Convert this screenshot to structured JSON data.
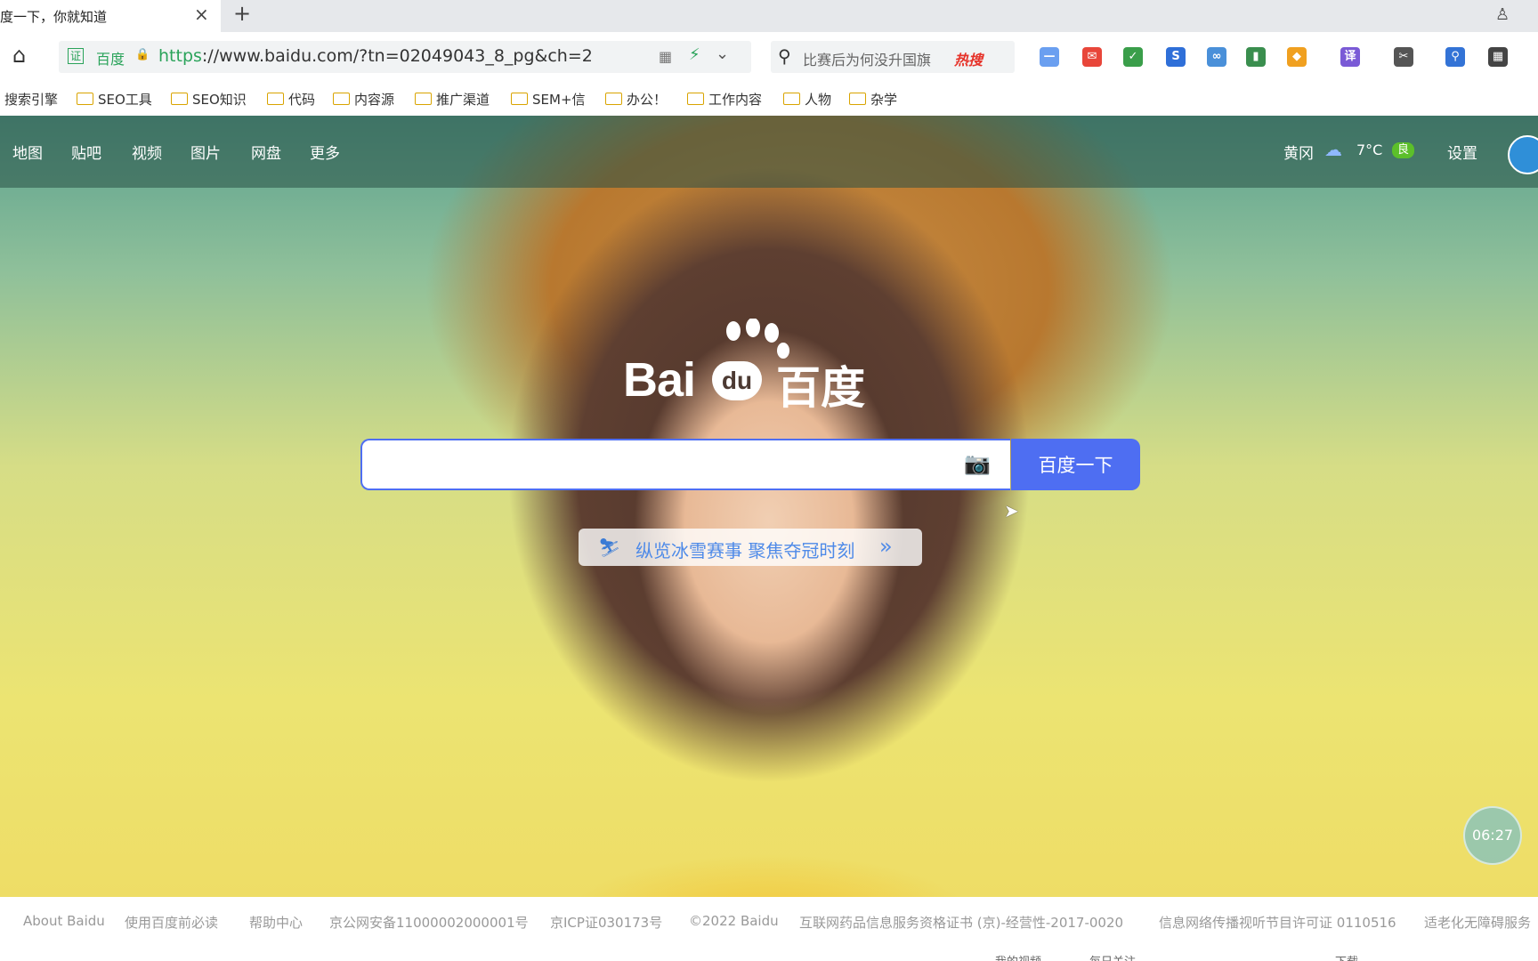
{
  "browser": {
    "tab_title": "度一下，你就知道",
    "tab_close": "×",
    "new_tab": "+",
    "address": {
      "cert_badge": "证",
      "cert_name": "百度",
      "url_scheme": "https",
      "url_rest": "://www.baidu.com/?tn=02049043_8_pg&ch=2"
    },
    "side_search": {
      "text": "比赛后为何没升国旗",
      "hot": "热搜"
    },
    "extensions": [
      "minus-icon",
      "message-icon",
      "check-icon",
      "sogou-icon",
      "link-icon",
      "chart-icon",
      "shield-icon",
      "translate-icon",
      "scissors-icon",
      "magnifier-icon",
      "grid-icon"
    ],
    "extension_labels": [
      "—",
      "✉",
      "✓",
      "S",
      "∞",
      "▮",
      "◆",
      "译",
      "✂",
      "⚲",
      "▦"
    ],
    "extension_colors": [
      "#6a9ff0",
      "#e8463a",
      "#3a9e4a",
      "#2f6fd8",
      "#4a90d9",
      "#3a8e4e",
      "#f0a020",
      "#7a5ad6",
      "#555555",
      "#3373d6",
      "#444444"
    ],
    "bookmarks": {
      "lead": "搜索引擎",
      "folders": [
        "SEO工具",
        "SEO知识",
        "代码",
        "内容源",
        "推广渠道",
        "SEM+信",
        "办公！",
        "工作内容",
        "人物",
        "杂学"
      ]
    }
  },
  "page": {
    "nav_left": [
      "地图",
      "贴吧",
      "视频",
      "图片",
      "网盘",
      "更多"
    ],
    "weather": {
      "city": "黄冈",
      "temp": "7°C",
      "aqi": "良"
    },
    "settings": "设置",
    "logo": {
      "latin": "Bai",
      "du": "du",
      "cn": "百度"
    },
    "search": {
      "value": "",
      "button": "百度一下"
    },
    "promo": {
      "text": "纵览冰雪赛事 聚焦夺冠时刻",
      "arrow": "»"
    },
    "timer": "06:27",
    "footer": [
      "About Baidu",
      "使用百度前必读",
      "帮助中心",
      "京公网安备11000002000001号",
      "京ICP证030173号",
      "©2022 Baidu",
      "互联网药品信息服务资格证书 (京)-经营性-2017-0020",
      "信息网络传播视听节目许可证 0110516",
      "适老化无障碍服务"
    ],
    "statusbar": [
      "我的视频",
      "每日关注",
      "下载"
    ]
  }
}
